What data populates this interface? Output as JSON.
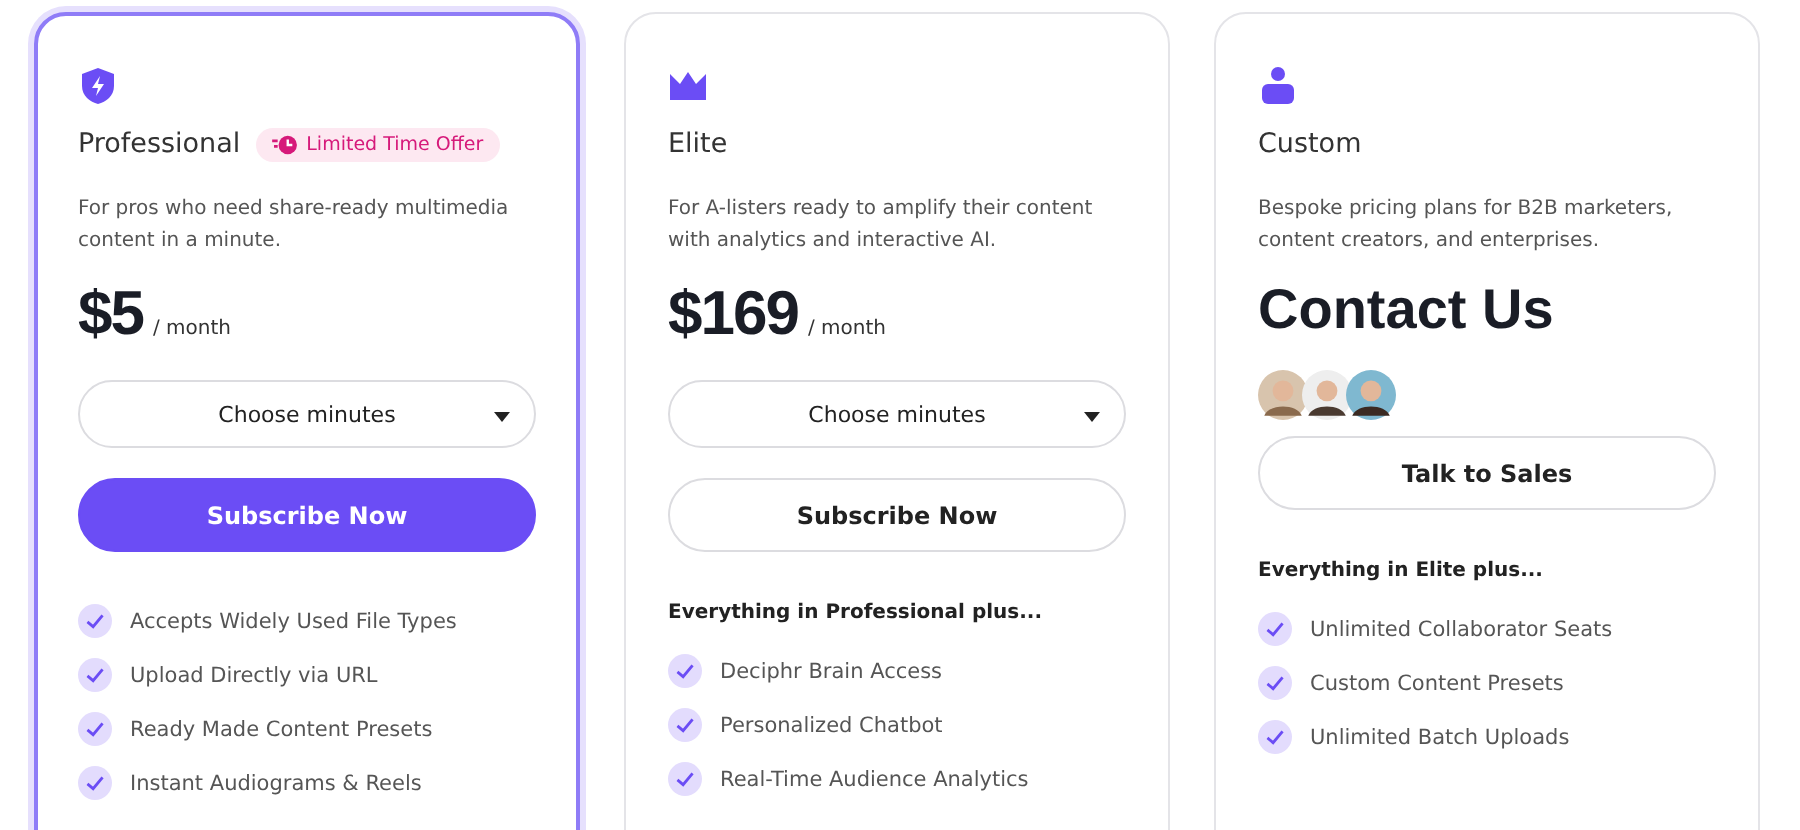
{
  "plans": [
    {
      "name": "Professional",
      "selected": true,
      "badge": "Limited Time Offer",
      "description": "For pros who need share-ready multimedia content in a minute.",
      "price": {
        "kind": "amount",
        "amount": "$5",
        "period": "/ month"
      },
      "dropdown": "Choose minutes",
      "button": {
        "label": "Subscribe Now",
        "primary": true
      },
      "features": [
        "Accepts Widely Used File Types",
        "Upload Directly via URL",
        "Ready Made Content Presets",
        "Instant Audiograms & Reels"
      ]
    },
    {
      "name": "Elite",
      "selected": false,
      "description": "For A-listers ready to amplify their content with analytics and interactive AI.",
      "price": {
        "kind": "amount",
        "amount": "$169",
        "period": "/ month"
      },
      "dropdown": "Choose minutes",
      "button": {
        "label": "Subscribe Now",
        "primary": false
      },
      "features_heading": "Everything in Professional plus...",
      "features": [
        "Deciphr Brain Access",
        "Personalized Chatbot",
        "Real-Time Audience Analytics"
      ]
    },
    {
      "name": "Custom",
      "selected": false,
      "description": "Bespoke pricing plans for B2B marketers, content creators, and enterprises.",
      "price": {
        "kind": "contact",
        "amount": "Contact Us"
      },
      "avatars": [
        {
          "kind": "picture"
        },
        {
          "kind": "picture"
        },
        {
          "kind": "picture"
        }
      ],
      "button": {
        "label": "Talk to Sales",
        "primary": false
      },
      "features_heading": "Everything in Elite plus...",
      "features": [
        "Unlimited Collaborator Seats",
        "Custom Content Presets",
        "Unlimited Batch Uploads"
      ]
    }
  ]
}
